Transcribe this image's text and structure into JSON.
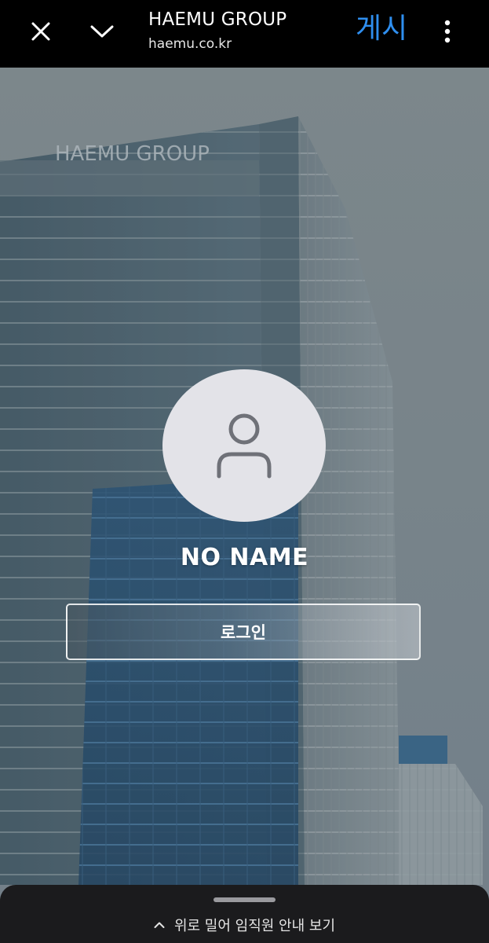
{
  "topbar": {
    "title": "HAEMU GROUP",
    "url": "haemu.co.kr",
    "post_label": "게시",
    "accent_color": "#2f8ff0",
    "icons": [
      "close-icon",
      "chevron-down-icon",
      "more-vertical-icon"
    ]
  },
  "profile": {
    "name": "NO NAME",
    "avatar_icon": "user-icon"
  },
  "login": {
    "label": "로그인"
  },
  "hero": {
    "building_sign": "HAEMU GROUP"
  },
  "bottom_sheet": {
    "hint": "위로 밀어 임직원 안내 보기",
    "icon": "chevron-up-icon"
  }
}
